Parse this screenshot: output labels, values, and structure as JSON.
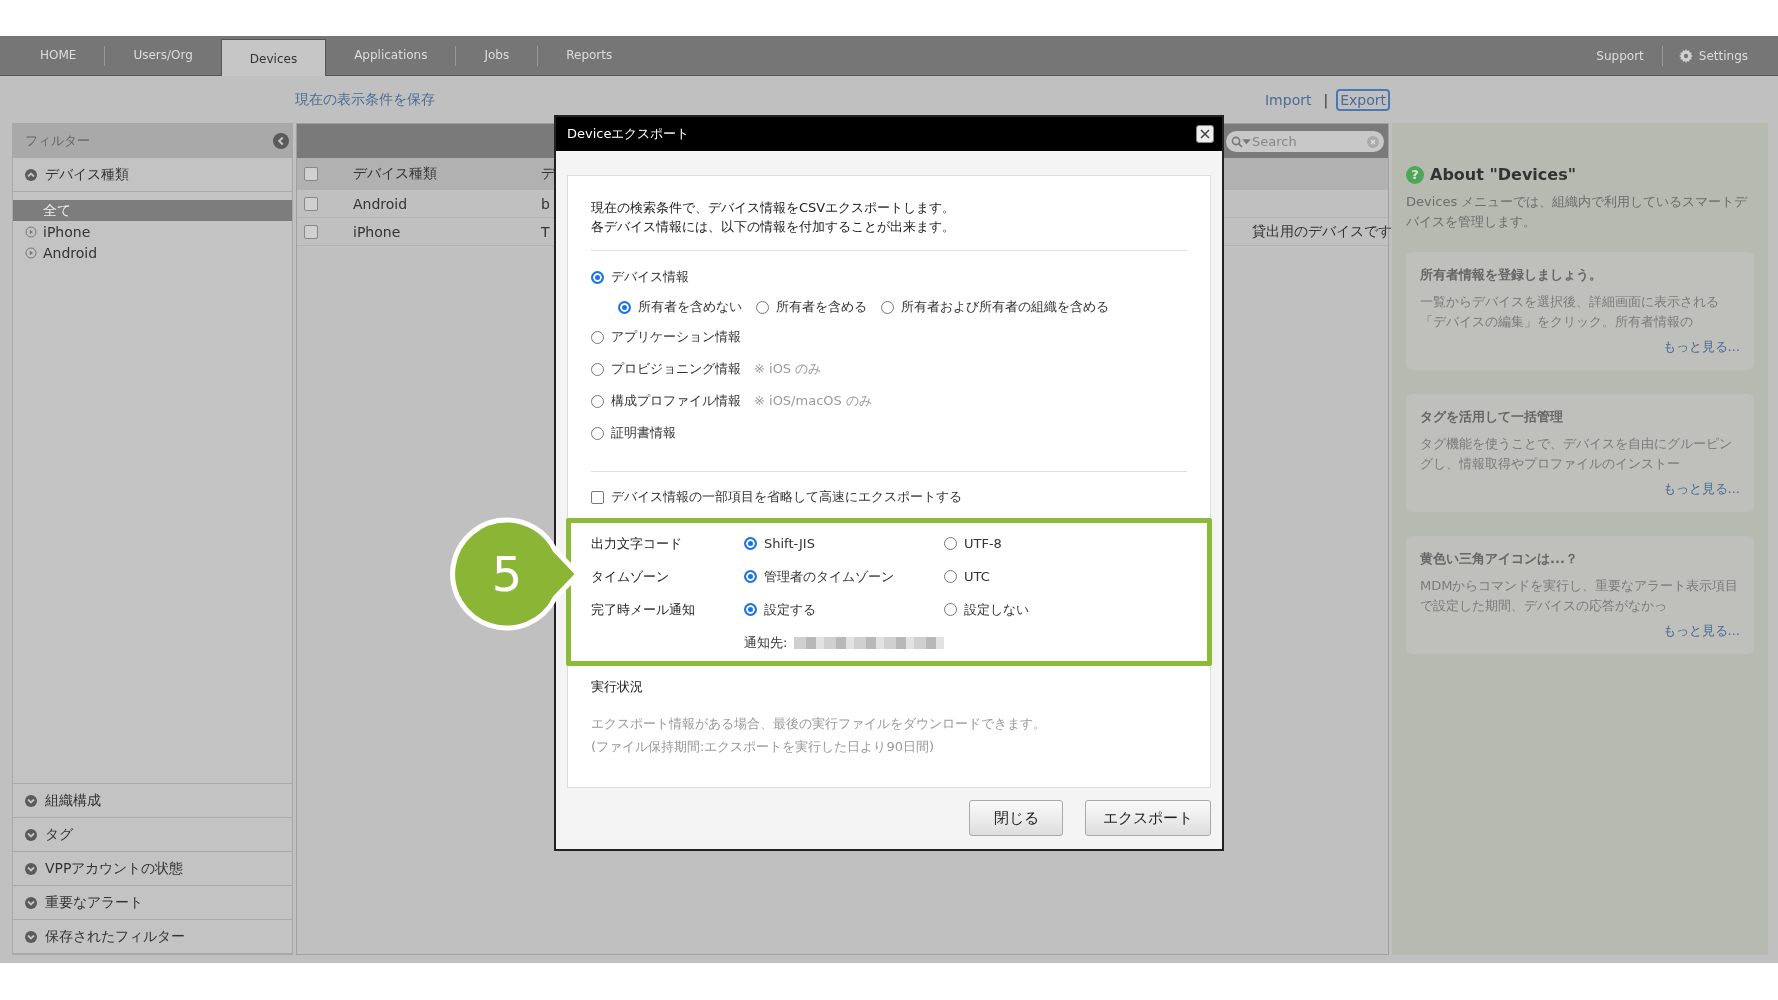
{
  "nav": {
    "tabs": [
      {
        "label": "HOME",
        "selected": false
      },
      {
        "label": "Users/Org",
        "selected": false
      },
      {
        "label": "Devices",
        "selected": true
      },
      {
        "label": "Applications",
        "selected": false
      },
      {
        "label": "Jobs",
        "selected": false
      },
      {
        "label": "Reports",
        "selected": false
      }
    ],
    "support": "Support",
    "settings": "Settings"
  },
  "toolbar": {
    "save_view": "現在の表示条件を保存",
    "separator": "|",
    "links": [
      {
        "label": "Import",
        "focused": false
      },
      {
        "label": "Export",
        "focused": true
      }
    ]
  },
  "sidebar": {
    "title": "フィルター",
    "sections": [
      {
        "label": "デバイス種類",
        "expanded": true,
        "items": [
          {
            "label": "全て",
            "selected": true
          },
          {
            "label": "iPhone",
            "selected": false
          },
          {
            "label": "Android",
            "selected": false
          }
        ]
      },
      {
        "label": "組織構成",
        "expanded": false
      },
      {
        "label": "タグ",
        "expanded": false
      },
      {
        "label": "VPPアカウントの状態",
        "expanded": false
      },
      {
        "label": "重要なアラート",
        "expanded": false
      },
      {
        "label": "保存されたフィルター",
        "expanded": false
      }
    ]
  },
  "table": {
    "search": {
      "placeholder": "Search"
    },
    "select_all_checked": false,
    "columns": [
      "デバイス種類",
      "デ"
    ],
    "rows": [
      {
        "checked": false,
        "cells": [
          "Android",
          "b"
        ]
      },
      {
        "checked": false,
        "cells": [
          "iPhone",
          "T",
          "貸出用のデバイスです"
        ]
      }
    ]
  },
  "about": {
    "help_icon": "?",
    "title": "About \"Devices\"",
    "description": "Devices メニューでは、組織内で利用しているスマートデバイスを管理します。",
    "cards": [
      {
        "title": "所有者情報を登録しましょう。",
        "body": "一覧からデバイスを選択後、詳細画面に表示される「デバイスの編集」をクリック。所有者情報の",
        "more": "もっと見る..."
      },
      {
        "title": "タグを活用して一括管理",
        "body": "タグ機能を使うことで、デバイスを自由にグルーピングし、情報取得やプロファイルのインストー",
        "more": "もっと見る..."
      },
      {
        "title": "黄色い三角アイコンは...？",
        "body": "MDMからコマンドを実行し、重要なアラート表示項目で設定した期間、デバイスの応答がなかっ",
        "more": "もっと見る..."
      }
    ]
  },
  "dialog": {
    "title": "Deviceエクスポート",
    "intro": [
      "現在の検索条件で、デバイス情報をCSVエクスポートします。",
      "各デバイス情報には、以下の情報を付加することが出来ます。"
    ],
    "options": [
      {
        "label": "デバイス情報",
        "selected": true,
        "sub_options": [
          {
            "label": "所有者を含めない",
            "selected": true
          },
          {
            "label": "所有者を含める",
            "selected": false
          },
          {
            "label": "所有者および所有者の組織を含める",
            "selected": false
          }
        ]
      },
      {
        "label": "アプリケーション情報",
        "selected": false
      },
      {
        "label": "プロビジョニング情報",
        "selected": false,
        "note": "※ iOS のみ"
      },
      {
        "label": "構成プロファイル情報",
        "selected": false,
        "note": "※ iOS/macOS のみ"
      },
      {
        "label": "証明書情報",
        "selected": false
      }
    ],
    "fast_export": {
      "label": "デバイス情報の一部項目を省略して高速にエクスポートする",
      "checked": false
    },
    "settings": [
      {
        "label": "出力文字コード",
        "options": [
          {
            "label": "Shift-JIS",
            "selected": true
          },
          {
            "label": "UTF-8",
            "selected": false
          }
        ]
      },
      {
        "label": "タイムゾーン",
        "options": [
          {
            "label": "管理者のタイムゾーン",
            "selected": true
          },
          {
            "label": "UTC",
            "selected": false
          }
        ]
      },
      {
        "label": "完了時メール通知",
        "options": [
          {
            "label": "設定する",
            "selected": true
          },
          {
            "label": "設定しない",
            "selected": false
          }
        ]
      }
    ],
    "notify_to": "通知先:",
    "status_title": "実行状況",
    "status_text": [
      "エクスポート情報がある場合、最後の実行ファイルをダウンロードできます。",
      "(ファイル保持期間:エクスポートを実行した日より90日間)"
    ],
    "buttons": [
      "閉じる",
      "エクスポート"
    ]
  },
  "callout": {
    "number": "5"
  }
}
